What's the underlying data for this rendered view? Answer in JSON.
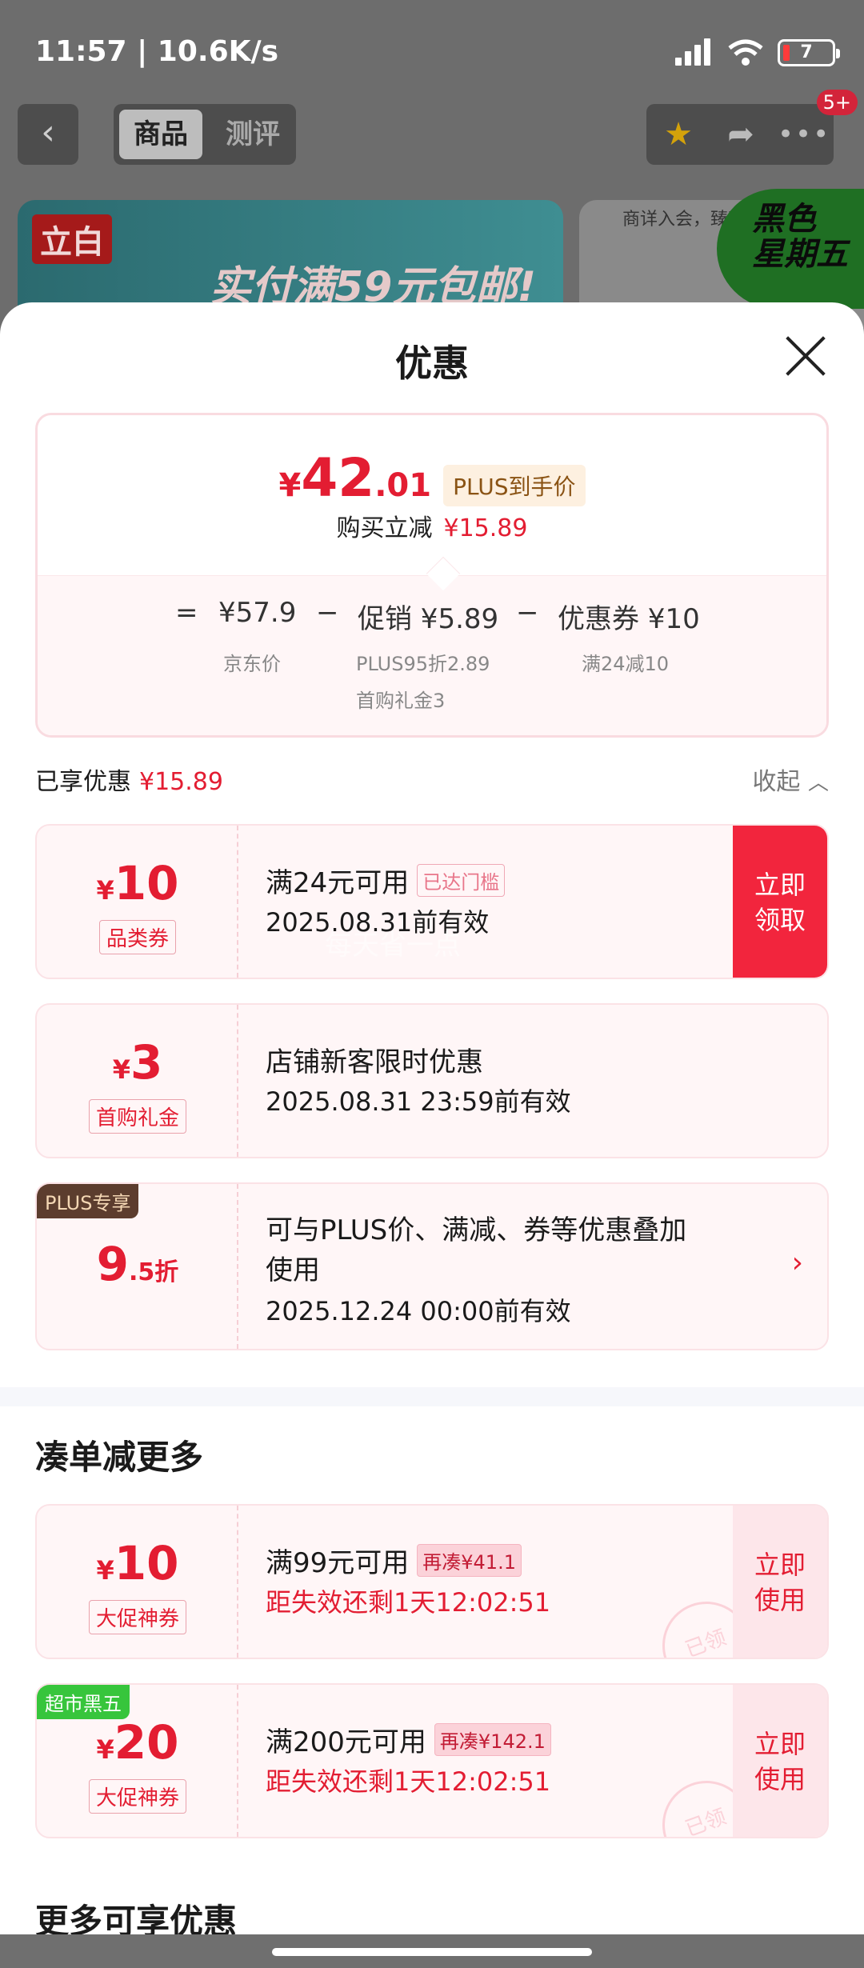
{
  "status_bar": {
    "time_speed": "11:57 | 10.6K/s",
    "battery": "7"
  },
  "top_nav": {
    "tabs": [
      {
        "label": "商品"
      },
      {
        "label": "测评"
      }
    ],
    "badge": "5+"
  },
  "banner": {
    "left_logo": "立白",
    "left_slogan": "实付满59元包邮!",
    "right_text": "商详入会，臻享",
    "black_friday": "黑色\n星期五"
  },
  "sheet": {
    "title": "优惠",
    "price": {
      "currency": "¥",
      "integer": "42",
      "decimal": ".01",
      "tag": "PLUS到手价",
      "reduce_label": "购买立减",
      "reduce_value": "¥15.89",
      "formula": {
        "eq": "=",
        "base": "¥57.9",
        "minus": "−",
        "promo": "促销 ¥5.89",
        "coupon": "优惠券 ¥10",
        "base_sub": "京东价",
        "promo_sub1": "PLUS95折2.89",
        "promo_sub2": "首购礼金3",
        "coupon_sub": "满24减10"
      }
    },
    "enjoyed": {
      "label": "已享优惠",
      "value": "¥15.89",
      "collapse": "收起"
    },
    "coupons": [
      {
        "cur": "¥",
        "amount": "10",
        "type": "品类券",
        "title": "满24元可用",
        "tag": "已达门槛",
        "line2": "2025.08.31前有效",
        "button": "立即\n领取",
        "watermark": "每天省一点"
      },
      {
        "cur": "¥",
        "amount": "3",
        "type": "首购礼金",
        "title": "店铺新客限时优惠",
        "line2": "2025.08.31 23:59前有效"
      },
      {
        "corner": "PLUS专享",
        "amount": "9",
        "unit": ".5折",
        "title": "可与PLUS价、满减、券等优惠叠加",
        "title2": "使用",
        "line2": "2025.12.24 00:00前有效"
      }
    ],
    "section_more": "凑单减更多",
    "more_coupons": [
      {
        "cur": "¥",
        "amount": "10",
        "type": "大促神券",
        "title": "满99元可用",
        "tag": "再凑¥41.1",
        "line2": "距失效还剩1天12:02:51",
        "button": "立即\n使用",
        "stamp": "已领"
      },
      {
        "corner": "超市黑五",
        "cur": "¥",
        "amount": "20",
        "type": "大促神券",
        "title": "满200元可用",
        "tag": "再凑¥142.1",
        "line2": "距失效还剩1天12:02:51",
        "button": "立即\n使用",
        "stamp": "已领"
      }
    ],
    "section_extra": "更多可享优惠"
  }
}
